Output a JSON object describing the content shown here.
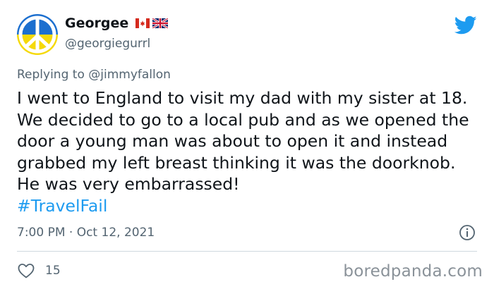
{
  "user": {
    "display_name": "Georgee",
    "handle": "@georgiegurrl",
    "flags": [
      "canada-flag-icon",
      "uk-flag-icon"
    ],
    "avatar": "peace-sign-avatar"
  },
  "reply": {
    "prefix": "Replying to",
    "mention": "@jimmyfallon"
  },
  "tweet": {
    "text": "I went to England to visit my dad with my sister at 18. We decided to go to a local pub and as we opened the door a young man was about to open it and instead grabbed my left breast thinking it was the doorknob. He was very embarrassed!",
    "hashtag": "#TravelFail",
    "timestamp": "7:00 PM · Oct 12, 2021"
  },
  "engagement": {
    "likes": "15"
  },
  "icons": {
    "brand": "twitter-bird-icon",
    "info": "info-icon",
    "like": "heart-icon"
  },
  "colors": {
    "link": "#1d9bf0",
    "secondary_text": "#536471",
    "avatar_blue": "#1c6fcf",
    "avatar_yellow": "#f5d90a"
  },
  "watermark": "boredpanda.com"
}
